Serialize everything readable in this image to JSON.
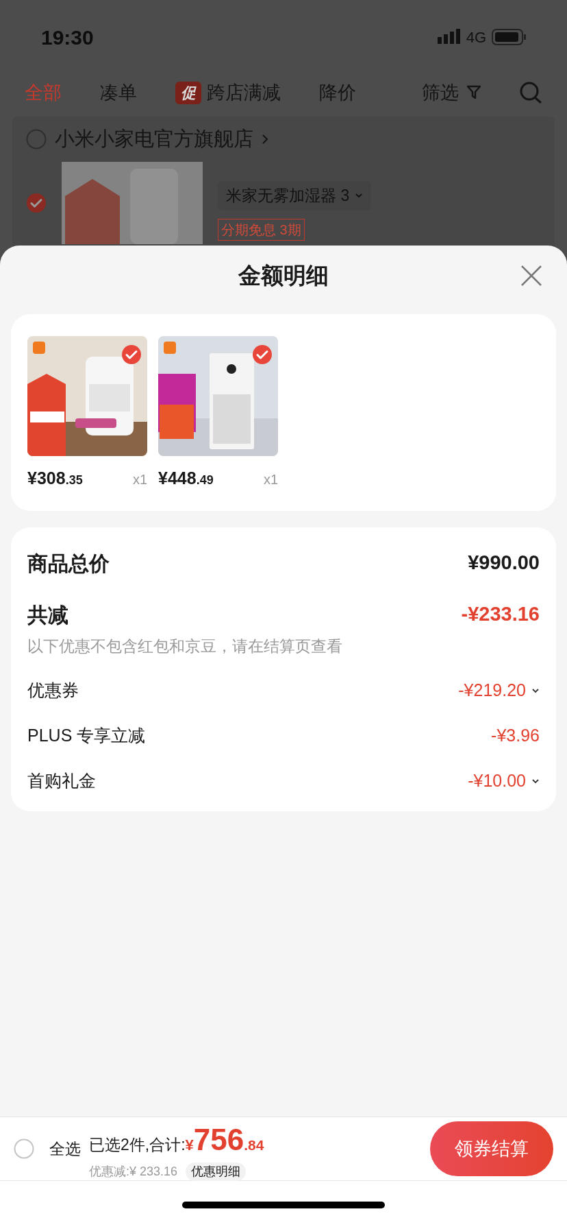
{
  "status_bar": {
    "time": "19:30",
    "network": "4G"
  },
  "tabs": [
    {
      "label": "全部",
      "selected": true
    },
    {
      "label": "凑单",
      "selected": false
    },
    {
      "label": "跨店满减",
      "badge": "促",
      "selected": false
    },
    {
      "label": "降价",
      "selected": false
    }
  ],
  "filter": {
    "label": "筛选"
  },
  "store": {
    "name": "小米小家电官方旗舰店",
    "checked": false
  },
  "cart_item": {
    "checked": true,
    "spec": "米家无雾加湿器 3",
    "tag_label": "分期免息",
    "tag_value": "3期"
  },
  "sheet": {
    "title": "金额明细"
  },
  "products": [
    {
      "price_main": "¥308",
      "price_cents": ".35",
      "quantity": "x1",
      "checked": true,
      "kind": "humidifier"
    },
    {
      "price_main": "¥448",
      "price_cents": ".49",
      "quantity": "x1",
      "checked": true,
      "kind": "purifier"
    }
  ],
  "summary": {
    "total_label": "商品总价",
    "total_value": "¥990.00",
    "discount_label": "共减",
    "discount_value": "-¥233.16",
    "note": "以下优惠不包含红包和京豆，请在结算页查看",
    "lines": [
      {
        "label": "优惠券",
        "value": "-¥219.20",
        "expandable": true
      },
      {
        "label": "PLUS 专享立减",
        "value": "-¥3.96",
        "expandable": false
      },
      {
        "label": "首购礼金",
        "value": "-¥10.00",
        "expandable": true
      }
    ]
  },
  "footer": {
    "select_all": {
      "label": "全选",
      "checked": false
    },
    "selected_text": "已选2件,合计:",
    "currency": "¥",
    "amount_main": "756",
    "amount_cents": ".84",
    "saved": "优惠减:¥ 233.16",
    "detail_button": "优惠明细",
    "checkout": "领券结算"
  }
}
